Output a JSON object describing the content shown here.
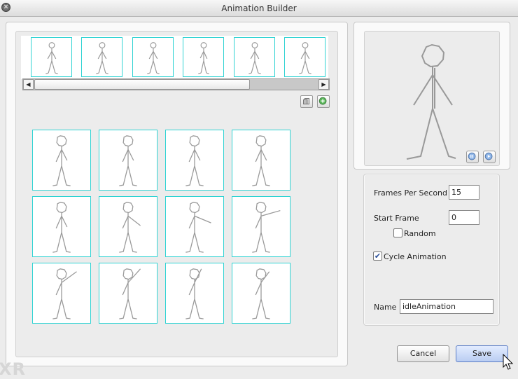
{
  "window": {
    "title": "Animation Builder"
  },
  "controls": {
    "fps_label": "Frames Per Second",
    "fps_value": "15",
    "start_frame_label": "Start Frame",
    "start_frame_value": "0",
    "random_label": "Random",
    "random_checked": false,
    "cycle_label": "Cycle Animation",
    "cycle_checked": true,
    "name_label": "Name",
    "name_value": "idleAnimation"
  },
  "buttons": {
    "cancel": "Cancel",
    "save": "Save"
  },
  "watermark": "XR",
  "colors": {
    "frame_border": "#2fd3d3",
    "accent": "#5a7cc4"
  },
  "preview": {
    "pause_icon": "pause-icon",
    "play_icon": "play-icon"
  },
  "strip": {
    "frame_count": 6
  },
  "grid": {
    "rows": 3,
    "cols": 4
  }
}
